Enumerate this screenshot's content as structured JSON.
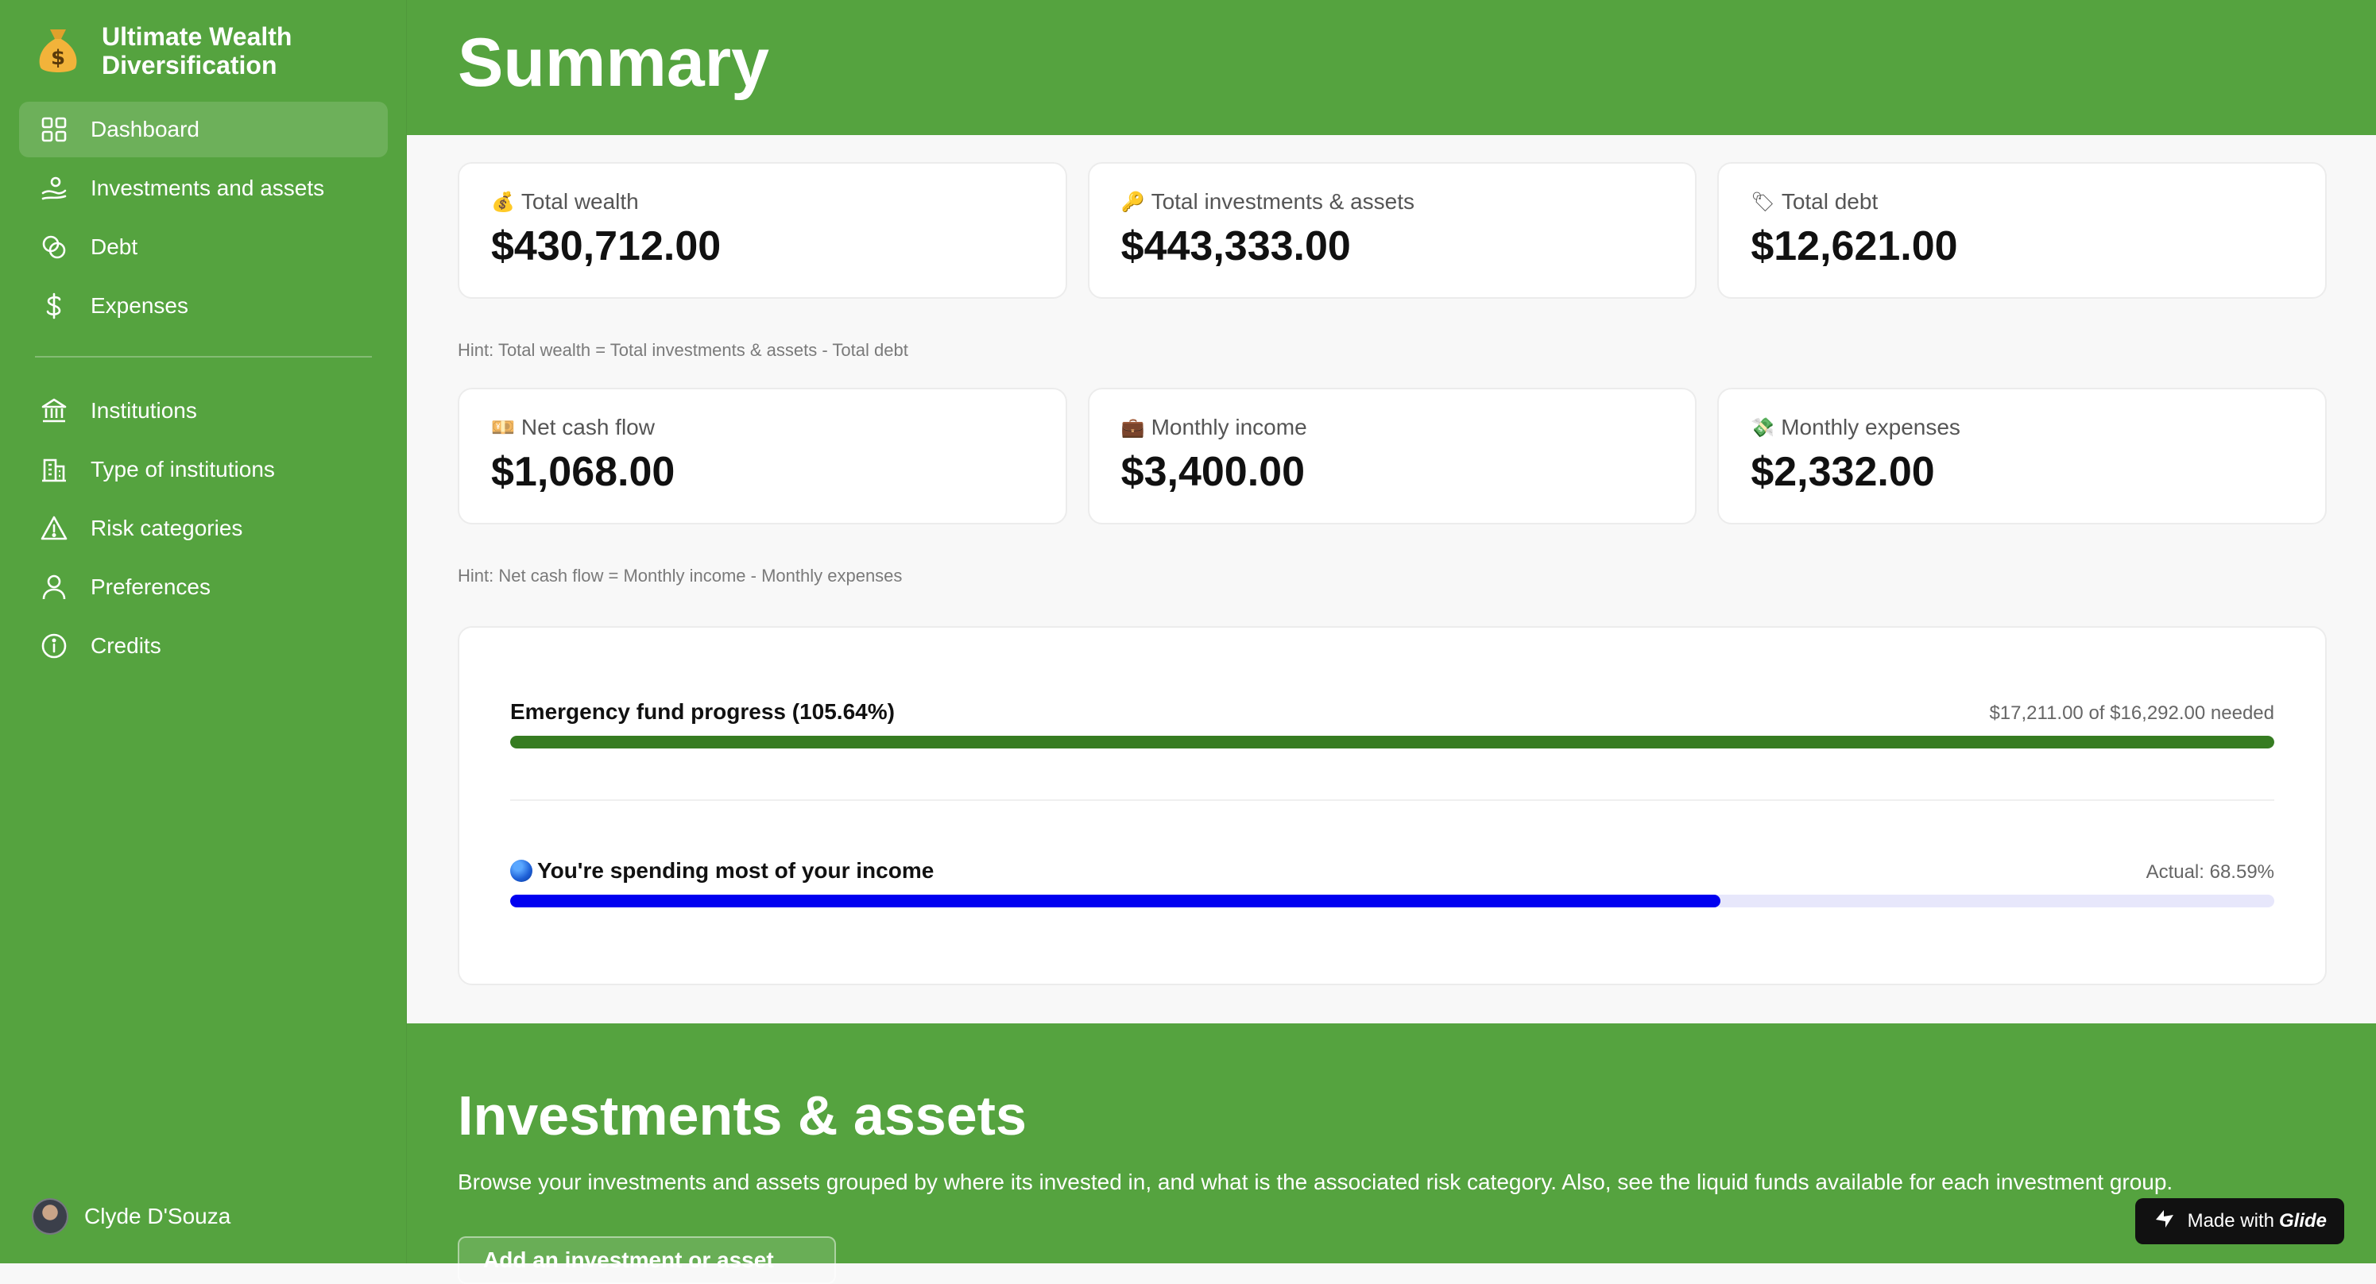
{
  "app": {
    "title": "Ultimate Wealth Diversification",
    "logo_icon": "money-bag-icon"
  },
  "sidebar": {
    "items": [
      {
        "label": "Dashboard",
        "icon": "grid-icon",
        "active": true
      },
      {
        "label": "Investments and assets",
        "icon": "investment-icon"
      },
      {
        "label": "Debt",
        "icon": "debt-icon"
      },
      {
        "label": "Expenses",
        "icon": "dollar-icon"
      },
      {
        "label": "Institutions",
        "icon": "bank-icon"
      },
      {
        "label": "Type of institutions",
        "icon": "building-icon"
      },
      {
        "label": "Risk categories",
        "icon": "warning-icon"
      },
      {
        "label": "Preferences",
        "icon": "user-icon"
      },
      {
        "label": "Credits",
        "icon": "info-icon"
      }
    ],
    "user": {
      "name": "Clyde D'Souza"
    }
  },
  "summary": {
    "title": "Summary",
    "row1": [
      {
        "label": "Total wealth",
        "value": "$430,712.00",
        "emoji": "💰"
      },
      {
        "label": "Total investments & assets",
        "value": "$443,333.00",
        "emoji": "🔑"
      },
      {
        "label": "Total debt",
        "value": "$12,621.00",
        "emoji": "🏷"
      }
    ],
    "hint1": "Hint: Total wealth = Total investments & assets - Total debt",
    "row2": [
      {
        "label": "Net cash flow",
        "value": "$1,068.00",
        "emoji": "💴"
      },
      {
        "label": "Monthly income",
        "value": "$3,400.00",
        "emoji": "💼"
      },
      {
        "label": "Monthly expenses",
        "value": "$2,332.00",
        "emoji": "💸"
      }
    ],
    "hint2": "Hint: Net cash flow = Monthly income - Monthly expenses"
  },
  "progress": {
    "emergency": {
      "title": "Emergency fund progress (105.64%)",
      "meta": "$17,211.00 of $16,292.00 needed",
      "fill_fraction": 1.0,
      "color": "#367c21"
    },
    "spending": {
      "title": "You're spending most of your income",
      "meta": "Actual: 68.59%",
      "fill_fraction": 0.6859,
      "color": "#0000f0",
      "track_color": "#e7e7fb"
    }
  },
  "investments_section": {
    "title": "Investments & assets",
    "description": "Browse your investments and assets grouped by where its invested in, and what is the associated risk category. Also, see the liquid funds available for each investment group.",
    "add_button": "Add an investment or asset"
  },
  "badge": {
    "prefix": "Made with",
    "brand": "Glide"
  },
  "colors": {
    "brand_green": "#55a33f"
  }
}
